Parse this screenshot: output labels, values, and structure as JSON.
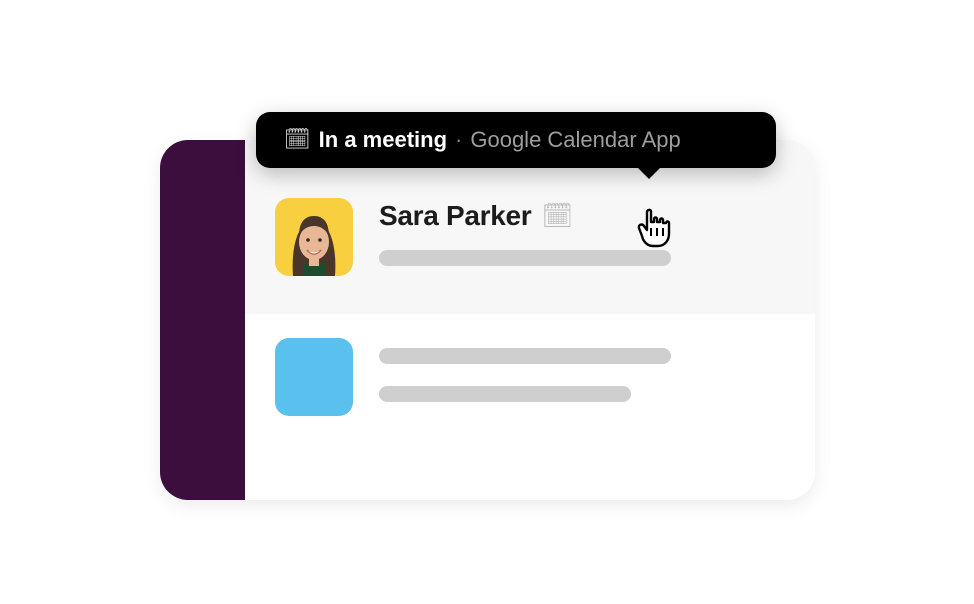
{
  "tooltip": {
    "icon": "🗓",
    "status": "In a meeting",
    "separator": "·",
    "app": "Google Calendar App"
  },
  "messages": [
    {
      "username": "Sara Parker",
      "status_icon": "🗓"
    }
  ]
}
